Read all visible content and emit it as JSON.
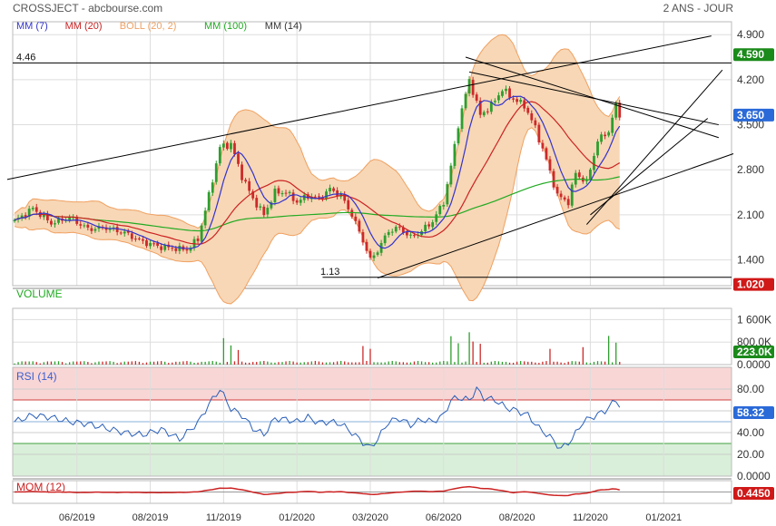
{
  "header": {
    "title": "CROSSJECT - abcbourse.com",
    "period": "2 ANS - JOUR",
    "legend": [
      {
        "label": "MM (7)",
        "color": "#3333cc"
      },
      {
        "label": "MM (20)",
        "color": "#cc2222"
      },
      {
        "label": "BOLL (20, 2)",
        "color": "#f0a060"
      },
      {
        "label": "MM (100)",
        "color": "#22aa22"
      },
      {
        "label": "MM (14)",
        "color": "#333333"
      }
    ]
  },
  "colors": {
    "grid": "#dddddd",
    "price_line": "#000000",
    "boll_fill": "#f7d7b6",
    "boll_line": "#f0a060",
    "mm7": "#3333cc",
    "mm20": "#cc2222",
    "mm100": "#22aa22",
    "up": "#2e9e2e",
    "down": "#cc2a2a",
    "badge_green": "#1a8a1a",
    "badge_blue": "#2a6ad8",
    "badge_red": "#d01818",
    "rsi_line": "#2a5fb8",
    "rsi_over": "#f9d6d6",
    "rsi_under": "#d9efd9",
    "mom_line": "#cc2222",
    "volume_label": "#22aa22",
    "rsi_label": "#3a5fcf",
    "mom_label": "#cc2222"
  },
  "chart_data": [
    {
      "type": "line",
      "panel": "price",
      "ylim": [
        1.0,
        5.1
      ],
      "y_ticks": [
        "4.900",
        "4.200",
        "3.500",
        "2.800",
        "2.100",
        "1.400"
      ],
      "y_tick_values": [
        4.9,
        4.2,
        3.5,
        2.8,
        2.1,
        1.4
      ],
      "x_ticks": [
        "06/2019",
        "08/2019",
        "11/2019",
        "01/2020",
        "03/2020",
        "06/2020",
        "08/2020",
        "11/2020",
        "01/2021"
      ],
      "x_tick_idx": [
        17,
        37,
        57,
        77,
        97,
        117,
        137,
        157,
        177
      ],
      "x_count": 196,
      "data_end_idx": 165,
      "close_anchors": [
        [
          0,
          2.0
        ],
        [
          5,
          2.2
        ],
        [
          10,
          1.97
        ],
        [
          15,
          2.06
        ],
        [
          20,
          1.88
        ],
        [
          25,
          1.9
        ],
        [
          30,
          1.82
        ],
        [
          35,
          1.68
        ],
        [
          40,
          1.6
        ],
        [
          45,
          1.57
        ],
        [
          47,
          1.56
        ],
        [
          50,
          1.72
        ],
        [
          53,
          2.4
        ],
        [
          56,
          3.15
        ],
        [
          59,
          3.2
        ],
        [
          62,
          2.7
        ],
        [
          65,
          2.35
        ],
        [
          68,
          2.1
        ],
        [
          71,
          2.45
        ],
        [
          74,
          2.45
        ],
        [
          77,
          2.3
        ],
        [
          80,
          2.4
        ],
        [
          83,
          2.35
        ],
        [
          86,
          2.5
        ],
        [
          89,
          2.4
        ],
        [
          92,
          2.1
        ],
        [
          95,
          1.7
        ],
        [
          97,
          1.4
        ],
        [
          99,
          1.55
        ],
        [
          102,
          1.85
        ],
        [
          105,
          1.9
        ],
        [
          108,
          1.75
        ],
        [
          111,
          1.85
        ],
        [
          114,
          2.0
        ],
        [
          117,
          2.3
        ],
        [
          119,
          2.85
        ],
        [
          121,
          3.5
        ],
        [
          124,
          4.2
        ],
        [
          127,
          3.65
        ],
        [
          130,
          3.8
        ],
        [
          133,
          4.05
        ],
        [
          136,
          3.9
        ],
        [
          139,
          3.8
        ],
        [
          142,
          3.45
        ],
        [
          145,
          2.95
        ],
        [
          148,
          2.4
        ],
        [
          151,
          2.3
        ],
        [
          153,
          2.75
        ],
        [
          156,
          2.6
        ],
        [
          159,
          3.25
        ],
        [
          162,
          3.4
        ],
        [
          164,
          3.8
        ],
        [
          165,
          3.65
        ]
      ],
      "series": [
        {
          "key": "mm7",
          "name": "MM (7)"
        },
        {
          "key": "mm20",
          "name": "MM (20)"
        },
        {
          "key": "mm100",
          "name": "MM (100)"
        },
        {
          "key": "boll",
          "name": "BOLL (20, 2)"
        }
      ],
      "hlines": [
        {
          "label": "4.46",
          "value": 4.46
        },
        {
          "label": "1.13",
          "value": 1.13
        }
      ],
      "trendlines": [
        [
          [
            -2,
            2.65
          ],
          [
            190,
            4.88
          ]
        ],
        [
          [
            123,
            4.55
          ],
          [
            192,
            3.3
          ]
        ],
        [
          [
            124,
            4.32
          ],
          [
            192,
            3.5
          ]
        ],
        [
          [
            99,
            1.12
          ],
          [
            196,
            3.05
          ]
        ],
        [
          [
            156,
            1.95
          ],
          [
            193,
            4.35
          ]
        ],
        [
          [
            157,
            2.1
          ],
          [
            189,
            3.6
          ]
        ]
      ],
      "badges": [
        {
          "label": "4.590",
          "value": 4.59,
          "color": "green"
        },
        {
          "label": "3.650",
          "value": 3.65,
          "color": "blue"
        },
        {
          "label": "1.020",
          "value": 1.02,
          "color": "red"
        }
      ]
    },
    {
      "type": "bar",
      "panel": "volume",
      "title": "VOLUME",
      "ylim": [
        0,
        2000
      ],
      "y_ticks": [
        "1 600K",
        "800.0K",
        "0.0000"
      ],
      "y_tick_values": [
        1600,
        800,
        0
      ],
      "unit": "K",
      "spikes": [
        [
          57,
          940
        ],
        [
          59,
          680
        ],
        [
          61,
          520
        ],
        [
          95,
          660
        ],
        [
          97,
          560
        ],
        [
          119,
          1010
        ],
        [
          121,
          760
        ],
        [
          124,
          1150
        ],
        [
          125,
          820
        ],
        [
          127,
          740
        ],
        [
          146,
          560
        ],
        [
          155,
          620
        ],
        [
          162,
          1020
        ],
        [
          164,
          780
        ],
        [
          166,
          660
        ]
      ],
      "last_label": "223.0K",
      "last_value": 223
    },
    {
      "type": "line",
      "panel": "rsi",
      "title": "RSI (14)",
      "ylim": [
        0,
        100
      ],
      "y_ticks": [
        "80.00",
        "60.00",
        "40.00",
        "20.00",
        "0.0000"
      ],
      "y_tick_values": [
        80,
        60,
        40,
        20,
        0
      ],
      "zones": {
        "upper": 70,
        "lower": 30,
        "mid": 50
      },
      "anchors": [
        [
          0,
          50
        ],
        [
          5,
          56
        ],
        [
          10,
          54
        ],
        [
          15,
          50
        ],
        [
          20,
          48
        ],
        [
          25,
          44
        ],
        [
          30,
          40
        ],
        [
          35,
          38
        ],
        [
          40,
          43
        ],
        [
          45,
          34
        ],
        [
          50,
          49
        ],
        [
          53,
          66
        ],
        [
          56,
          80
        ],
        [
          59,
          62
        ],
        [
          62,
          56
        ],
        [
          65,
          44
        ],
        [
          68,
          38
        ],
        [
          71,
          53
        ],
        [
          74,
          52
        ],
        [
          77,
          50
        ],
        [
          80,
          54
        ],
        [
          83,
          49
        ],
        [
          86,
          50
        ],
        [
          89,
          48
        ],
        [
          92,
          40
        ],
        [
          95,
          31
        ],
        [
          97,
          26
        ],
        [
          99,
          34
        ],
        [
          102,
          50
        ],
        [
          105,
          53
        ],
        [
          108,
          47
        ],
        [
          111,
          52
        ],
        [
          114,
          50
        ],
        [
          117,
          56
        ],
        [
          119,
          70
        ],
        [
          121,
          72
        ],
        [
          124,
          70
        ],
        [
          126,
          80
        ],
        [
          128,
          72
        ],
        [
          131,
          70
        ],
        [
          134,
          63
        ],
        [
          137,
          60
        ],
        [
          140,
          56
        ],
        [
          143,
          44
        ],
        [
          146,
          36
        ],
        [
          149,
          25
        ],
        [
          152,
          34
        ],
        [
          155,
          50
        ],
        [
          158,
          55
        ],
        [
          161,
          60
        ],
        [
          164,
          70
        ],
        [
          165,
          65
        ]
      ],
      "last_label": "58.32",
      "last_value": 58.32
    },
    {
      "type": "line",
      "panel": "mom",
      "title": "MOM (12)",
      "ylim": [
        -1.2,
        1.2
      ],
      "last_label": "0.4450",
      "last_value": 0.445
    }
  ]
}
